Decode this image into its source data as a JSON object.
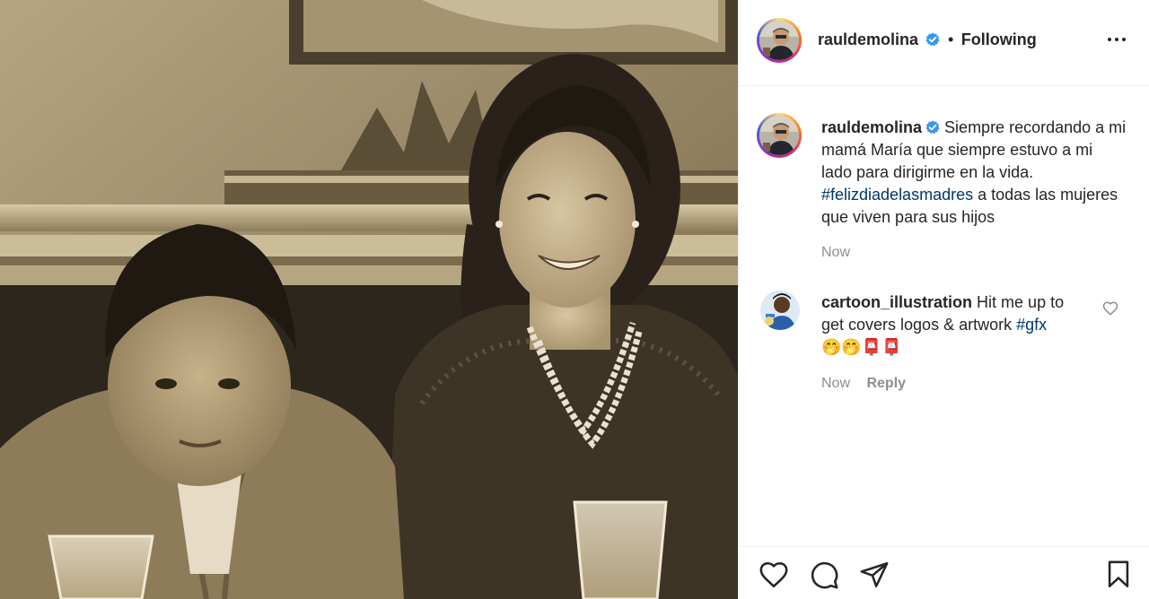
{
  "post": {
    "author": {
      "username": "rauldemolina",
      "verified": true,
      "follow_status": "Following",
      "separator": "•"
    },
    "caption": {
      "username": "rauldemolina",
      "text_1": "Siempre recordando a mi mamá María que siempre estuvo a mi lado para dirigirme en la vida.",
      "hashtag": "#felizdiadelasmadres",
      "text_2": "a todas las mujeres que viven para sus hijos",
      "timestamp": "Now"
    },
    "comments": [
      {
        "username": "cartoon_illustration",
        "text": "Hit me up to get covers logos & artwork",
        "hashtag": "#gfx",
        "emojis": "🤭🤭📮📮",
        "timestamp": "Now",
        "reply_label": "Reply"
      }
    ],
    "actions": {
      "like": "heart-icon",
      "comment": "comment-icon",
      "share": "share-icon",
      "save": "bookmark-icon"
    },
    "more_icon": "more-options-icon"
  },
  "colors": {
    "text": "#262626",
    "muted": "#8e8e8e",
    "hashtag": "#00376b",
    "verified": "#3897f0",
    "divider": "#efefef"
  }
}
